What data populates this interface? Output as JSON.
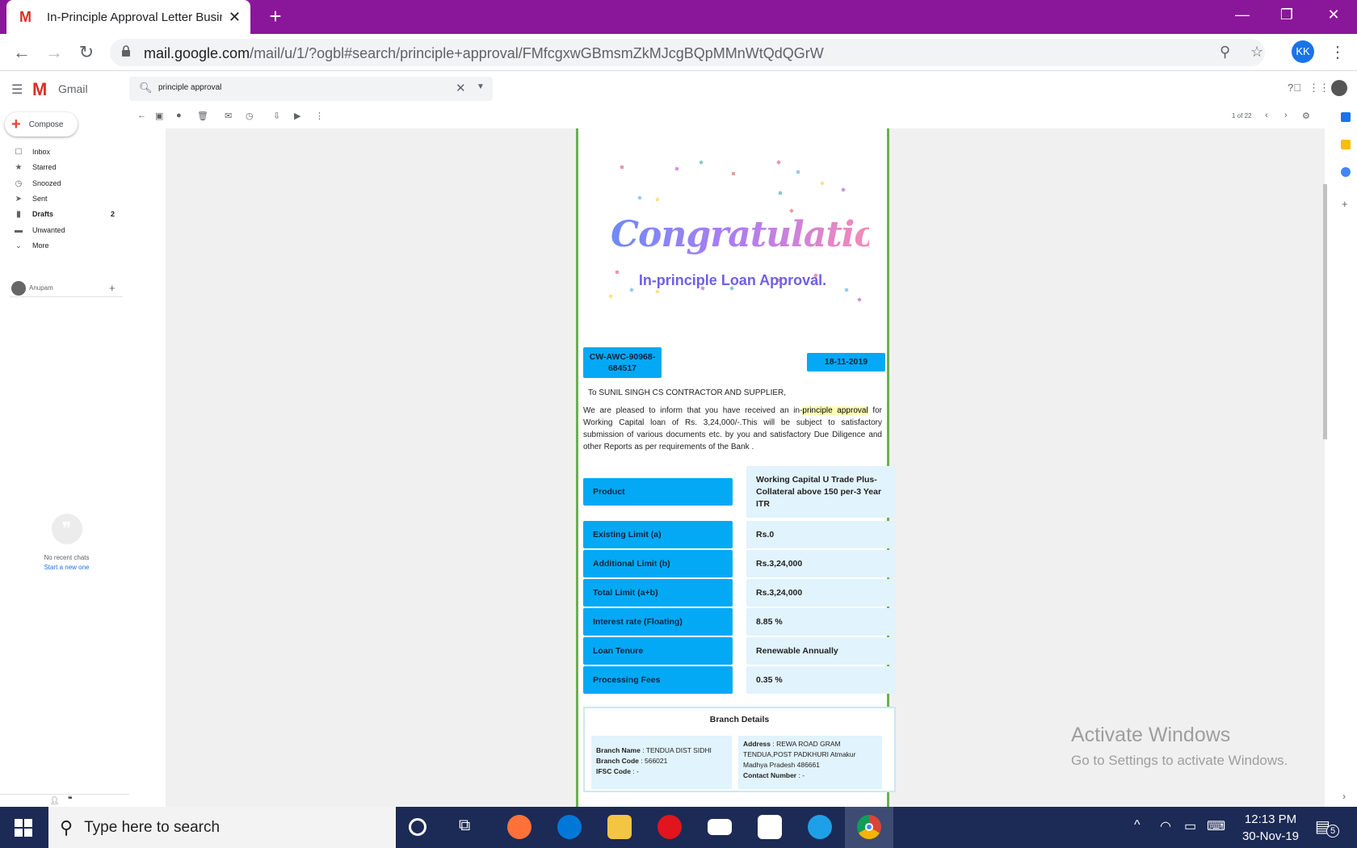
{
  "browser": {
    "tab_title": "In-Principle Approval Letter Busin",
    "url_host": "mail.google.com",
    "url_path": "/mail/u/1/?ogbl#search/principle+approval/FMfcgxwGBmsmZkMJcgBQpMMnWtQdQGrW",
    "profile_initials": "KK"
  },
  "gmail": {
    "app_name": "Gmail",
    "search_value": "principle approval",
    "compose_label": "Compose",
    "nav": [
      {
        "label": "Inbox",
        "count": ""
      },
      {
        "label": "Starred",
        "count": ""
      },
      {
        "label": "Snoozed",
        "count": ""
      },
      {
        "label": "Sent",
        "count": ""
      },
      {
        "label": "Drafts",
        "count": "2"
      },
      {
        "label": "Unwanted",
        "count": ""
      },
      {
        "label": "More",
        "count": ""
      }
    ],
    "hangouts_user": "Anupam",
    "no_chats": "No recent chats",
    "start_chat": "Start a new one",
    "pager": "1 of 22"
  },
  "letter": {
    "headline": "Congratulations",
    "subtitle": "In-principle Loan Approval.",
    "reference": "CW-AWC-90968-684517",
    "date": "18-11-2019",
    "to_line": "To SUNIL SINGH CS CONTRACTOR AND SUPPLIER,",
    "para_before": "We are pleased to inform that you have received an in-",
    "para_highlight": "principle approval",
    "para_after": " for Working Capital loan of Rs. 3,24,000/-.This will be subject to satisfactory submission of various documents etc. by you and satisfactory Due Diligence and other Reports as per requirements of the Bank .",
    "rows": [
      {
        "label": "Product",
        "value": "Working Capital U Trade Plus-Collateral above 150 per-3 Year ITR"
      },
      {
        "label": "Existing Limit (a)",
        "value": "Rs.0"
      },
      {
        "label": "Additional Limit (b)",
        "value": "Rs.3,24,000"
      },
      {
        "label": "Total Limit (a+b)",
        "value": "Rs.3,24,000"
      },
      {
        "label": "Interest rate (Floating)",
        "value": "8.85 %"
      },
      {
        "label": "Loan Tenure",
        "value": "Renewable Annually"
      },
      {
        "label": "Processing Fees",
        "value": "0.35 %"
      }
    ],
    "branch": {
      "title": "Branch Details",
      "name_label": "Branch Name",
      "name_value": ": TENDUA DIST SIDHI",
      "code_label": "Branch Code",
      "code_value": ": 566021",
      "ifsc_label": "IFSC Code",
      "ifsc_value": ": -",
      "address_label": "Address",
      "address_value": ": REWA ROAD GRAM TENDUA,POST PADKHURI Atmakur Madhya Pradesh 486661",
      "contact_label": "Contact Number",
      "contact_value": ": -"
    }
  },
  "watermark": {
    "line1": "Activate Windows",
    "line2": "Go to Settings to activate Windows."
  },
  "taskbar": {
    "search_placeholder": "Type here to search",
    "time": "12:13 PM",
    "date": "30-Nov-19",
    "notifications": "5"
  }
}
